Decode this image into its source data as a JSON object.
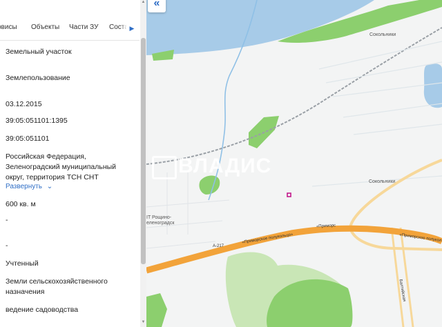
{
  "tabs": [
    "рвисы",
    "Объекты",
    "Части ЗУ",
    "Соста"
  ],
  "tab_next_icon": "chevron-right-icon",
  "info": {
    "type": "Земельный участок",
    "right": "Землепользование",
    "date": "03.12.2015",
    "cad_number": "39:05:051101:1395",
    "quarter": "39:05:051101",
    "address": "Российская Федерация, Зеленоградский муниципальный округ, территория ТСН СНТ",
    "expand_label": "Развернуть",
    "area": "600 кв. м",
    "dash1": "-",
    "dash2": "-",
    "status": "Учтенный",
    "category": "Земли сельскохозяйственного назначения",
    "usage": "ведение садоводства"
  },
  "map": {
    "collapse_icon": "double-chevron-left-icon",
    "labels": {
      "sokolniki_top": "Сокольники",
      "sokolniki_mid": "Сокольники",
      "roshino": "IT Рощино-",
      "zelenogradsk": "еленоградск",
      "road1": "«Приморское полукольцо»",
      "road2": "«Приморс",
      "road3": "«Приморское полукол",
      "road_a217": "A-217",
      "baltiyskaya": "Балтийская"
    },
    "watermark": "ВЛАДИС",
    "colors": {
      "water": "#a7cbe8",
      "park": "#8ccf6e",
      "highway": "#f2a33a",
      "marker": "#c2188b"
    }
  }
}
